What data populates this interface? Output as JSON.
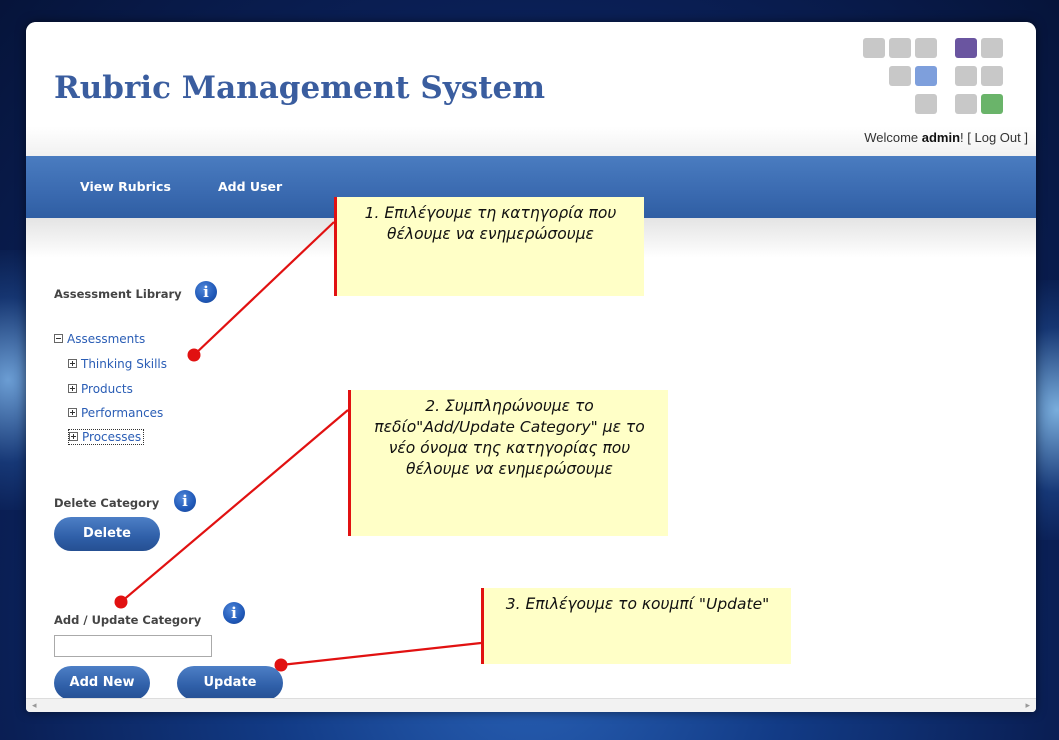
{
  "app": {
    "title": "Rubric Management System",
    "welcome_prefix": "Welcome ",
    "username": "admin",
    "welcome_suffix": "! [ ",
    "logout_label": "Log Out",
    "logout_close": " ]"
  },
  "nav": {
    "items": [
      {
        "label": "View Rubrics"
      },
      {
        "label": "Add User"
      }
    ]
  },
  "library": {
    "label": "Assessment Library",
    "root": "Assessments",
    "children": [
      "Thinking Skills",
      "Products",
      "Performances",
      "Processes"
    ]
  },
  "delete_section": {
    "label": "Delete Category",
    "button_label": "Delete"
  },
  "add_update_section": {
    "label": "Add / Update Category",
    "input_value": "",
    "add_button_label": "Add New",
    "update_button_label": "Update"
  },
  "annotations": {
    "note1": "1. Επιλέγουμε τη κατηγορία που θέλουμε να ενημερώσουμε",
    "note2": "2. Συμπληρώνουμε το πεδίο\"Add/Update Category\" με το νέο όνομα της κατηγορίας που θέλουμε να ενημερώσουμε",
    "note3": "3. Επιλέγουμε το κουμπί \"Update\""
  },
  "icons": {
    "info": "info-icon",
    "tree_collapse": "minus-box-icon",
    "tree_expand": "plus-box-icon",
    "scroll_left": "arrow-left-icon",
    "scroll_right": "arrow-right-icon"
  },
  "colors": {
    "brand_blue": "#3a6ab0",
    "title_blue": "#3a5d9f",
    "annotation_red": "#e11111",
    "note_background": "#ffffc7",
    "logo_purple": "#6a55a0",
    "logo_blue": "#7e9fdc",
    "logo_green": "#6ab46a"
  }
}
